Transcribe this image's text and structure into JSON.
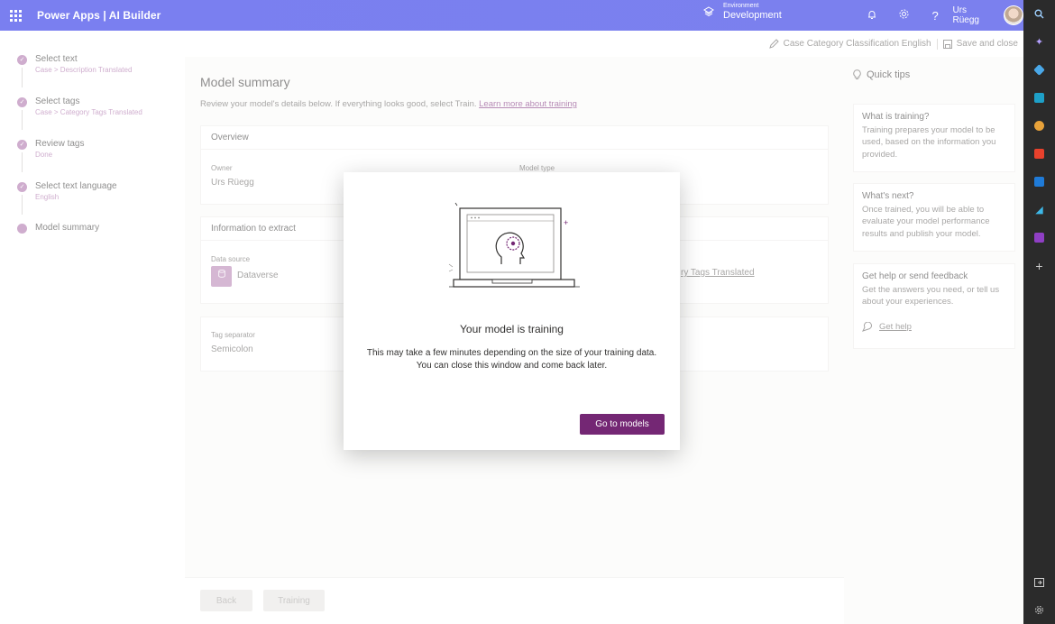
{
  "header": {
    "brand": "Power Apps  |  AI Builder",
    "environment_label": "Environment",
    "environment_value": "Development",
    "user_name": "Urs Rüegg"
  },
  "steps": [
    {
      "title": "Select text",
      "sub": "Case > Description Translated",
      "done": true
    },
    {
      "title": "Select tags",
      "sub": "Case > Category Tags Translated",
      "done": true
    },
    {
      "title": "Review tags",
      "sub": "Done",
      "done": true
    },
    {
      "title": "Select text language",
      "sub": "English",
      "done": true
    },
    {
      "title": "Model summary",
      "sub": "",
      "done": false
    }
  ],
  "cmdbar": {
    "model_name": "Case Category Classification English",
    "save_close": "Save and close"
  },
  "main": {
    "title": "Model summary",
    "desc": "Review your model's details below. If everything looks good, select Train.",
    "learn_link": "Learn more about training",
    "overview": {
      "heading": "Overview",
      "owner_label": "Owner",
      "owner_value": "Urs Rüegg",
      "model_type_label": "Model type"
    },
    "extract": {
      "heading": "Information to extract",
      "source_label": "Data source",
      "source_value": "Dataverse",
      "partial_link": "ry Tags Translated"
    },
    "separator": {
      "label": "Tag separator",
      "value": "Semicolon"
    },
    "footer": {
      "back": "Back",
      "training": "Training"
    }
  },
  "tips": {
    "title": "Quick tips",
    "cards": [
      {
        "h": "What is training?",
        "b": "Training prepares your model to be used, based on the information you provided."
      },
      {
        "h": "What's next?",
        "b": "Once trained, you will be able to evaluate your model performance results and publish your model."
      },
      {
        "h": "Get help or send feedback",
        "b": "Get the answers you need, or tell us about your experiences.",
        "link": "Get help"
      }
    ]
  },
  "dialog": {
    "title": "Your model is training",
    "desc_line1": "This may take a few minutes depending on the size of your training data.",
    "desc_line2": "You can close this window and come back later.",
    "button": "Go to models"
  },
  "colors": {
    "topbar": "#7b83eb",
    "accent": "#742774",
    "step": "#a86ba6"
  }
}
